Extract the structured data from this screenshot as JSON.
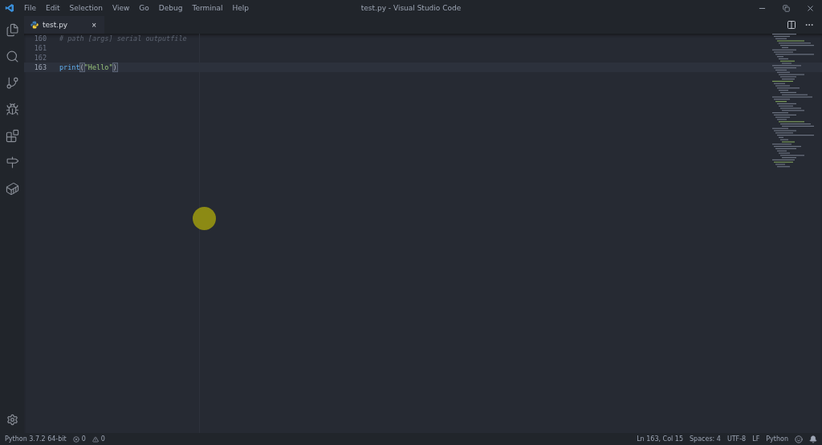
{
  "window": {
    "title": "test.py - Visual Studio Code"
  },
  "menu": [
    "File",
    "Edit",
    "Selection",
    "View",
    "Go",
    "Debug",
    "Terminal",
    "Help"
  ],
  "activity_bar": [
    {
      "kind": "files",
      "selected": false
    },
    {
      "kind": "search",
      "selected": false
    },
    {
      "kind": "source-control",
      "selected": false
    },
    {
      "kind": "debug",
      "selected": false
    },
    {
      "kind": "extensions",
      "selected": false
    },
    {
      "kind": "git-graph",
      "selected": false
    },
    {
      "kind": "docker",
      "selected": false
    }
  ],
  "tabs": [
    {
      "label": "test.py",
      "close": "×",
      "selected": true
    }
  ],
  "editor": {
    "lines": [
      {
        "number": "160",
        "current": false,
        "tokens": [
          {
            "kind": "comment",
            "text": "# path [args] serial outputfile"
          }
        ]
      },
      {
        "number": "161",
        "current": false
      },
      {
        "number": "162",
        "current": false
      },
      {
        "number": "163",
        "current": true,
        "tokens": [
          {
            "kind": "function",
            "text": "print"
          },
          {
            "kind": "bracket",
            "text": "("
          },
          {
            "kind": "string",
            "text": "\"Hello\""
          },
          {
            "kind": "bracket",
            "text": ")"
          }
        ]
      }
    ]
  },
  "status_bar": {
    "left": [
      {
        "kind": "text",
        "text": "Python 3.7.2 64-bit"
      },
      {
        "kind": "errors",
        "text": "0"
      },
      {
        "kind": "warnings",
        "text": "0"
      }
    ],
    "right": [
      {
        "kind": "text",
        "text": "Ln 163, Col 15"
      },
      {
        "kind": "text",
        "text": "Spaces: 4"
      },
      {
        "kind": "text",
        "text": "UTF-8"
      },
      {
        "kind": "text",
        "text": "LF"
      },
      {
        "kind": "text",
        "text": "Python"
      },
      {
        "kind": "feedback"
      },
      {
        "kind": "bell"
      }
    ]
  }
}
